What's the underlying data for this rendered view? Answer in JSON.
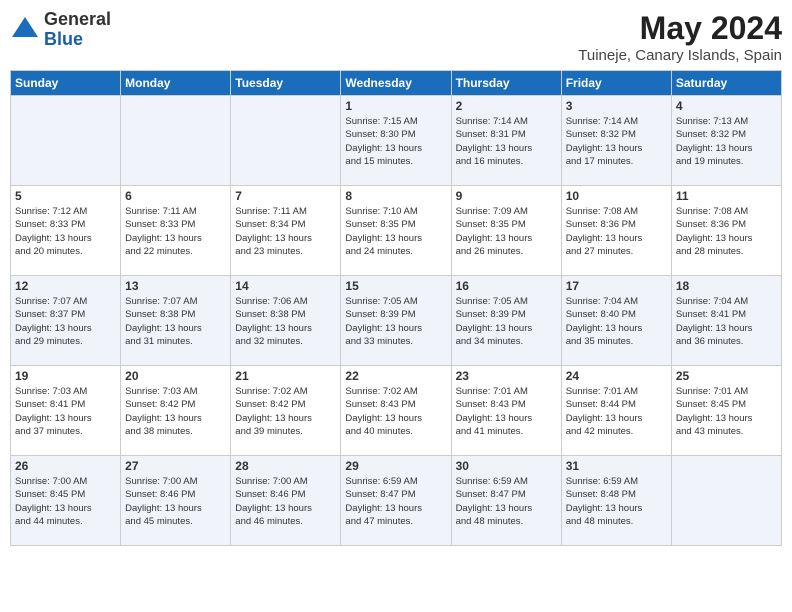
{
  "header": {
    "logo_general": "General",
    "logo_blue": "Blue",
    "month_year": "May 2024",
    "location": "Tuineje, Canary Islands, Spain"
  },
  "days_of_week": [
    "Sunday",
    "Monday",
    "Tuesday",
    "Wednesday",
    "Thursday",
    "Friday",
    "Saturday"
  ],
  "weeks": [
    [
      {
        "day": "",
        "info": ""
      },
      {
        "day": "",
        "info": ""
      },
      {
        "day": "",
        "info": ""
      },
      {
        "day": "1",
        "info": "Sunrise: 7:15 AM\nSunset: 8:30 PM\nDaylight: 13 hours\nand 15 minutes."
      },
      {
        "day": "2",
        "info": "Sunrise: 7:14 AM\nSunset: 8:31 PM\nDaylight: 13 hours\nand 16 minutes."
      },
      {
        "day": "3",
        "info": "Sunrise: 7:14 AM\nSunset: 8:32 PM\nDaylight: 13 hours\nand 17 minutes."
      },
      {
        "day": "4",
        "info": "Sunrise: 7:13 AM\nSunset: 8:32 PM\nDaylight: 13 hours\nand 19 minutes."
      }
    ],
    [
      {
        "day": "5",
        "info": "Sunrise: 7:12 AM\nSunset: 8:33 PM\nDaylight: 13 hours\nand 20 minutes."
      },
      {
        "day": "6",
        "info": "Sunrise: 7:11 AM\nSunset: 8:33 PM\nDaylight: 13 hours\nand 22 minutes."
      },
      {
        "day": "7",
        "info": "Sunrise: 7:11 AM\nSunset: 8:34 PM\nDaylight: 13 hours\nand 23 minutes."
      },
      {
        "day": "8",
        "info": "Sunrise: 7:10 AM\nSunset: 8:35 PM\nDaylight: 13 hours\nand 24 minutes."
      },
      {
        "day": "9",
        "info": "Sunrise: 7:09 AM\nSunset: 8:35 PM\nDaylight: 13 hours\nand 26 minutes."
      },
      {
        "day": "10",
        "info": "Sunrise: 7:08 AM\nSunset: 8:36 PM\nDaylight: 13 hours\nand 27 minutes."
      },
      {
        "day": "11",
        "info": "Sunrise: 7:08 AM\nSunset: 8:36 PM\nDaylight: 13 hours\nand 28 minutes."
      }
    ],
    [
      {
        "day": "12",
        "info": "Sunrise: 7:07 AM\nSunset: 8:37 PM\nDaylight: 13 hours\nand 29 minutes."
      },
      {
        "day": "13",
        "info": "Sunrise: 7:07 AM\nSunset: 8:38 PM\nDaylight: 13 hours\nand 31 minutes."
      },
      {
        "day": "14",
        "info": "Sunrise: 7:06 AM\nSunset: 8:38 PM\nDaylight: 13 hours\nand 32 minutes."
      },
      {
        "day": "15",
        "info": "Sunrise: 7:05 AM\nSunset: 8:39 PM\nDaylight: 13 hours\nand 33 minutes."
      },
      {
        "day": "16",
        "info": "Sunrise: 7:05 AM\nSunset: 8:39 PM\nDaylight: 13 hours\nand 34 minutes."
      },
      {
        "day": "17",
        "info": "Sunrise: 7:04 AM\nSunset: 8:40 PM\nDaylight: 13 hours\nand 35 minutes."
      },
      {
        "day": "18",
        "info": "Sunrise: 7:04 AM\nSunset: 8:41 PM\nDaylight: 13 hours\nand 36 minutes."
      }
    ],
    [
      {
        "day": "19",
        "info": "Sunrise: 7:03 AM\nSunset: 8:41 PM\nDaylight: 13 hours\nand 37 minutes."
      },
      {
        "day": "20",
        "info": "Sunrise: 7:03 AM\nSunset: 8:42 PM\nDaylight: 13 hours\nand 38 minutes."
      },
      {
        "day": "21",
        "info": "Sunrise: 7:02 AM\nSunset: 8:42 PM\nDaylight: 13 hours\nand 39 minutes."
      },
      {
        "day": "22",
        "info": "Sunrise: 7:02 AM\nSunset: 8:43 PM\nDaylight: 13 hours\nand 40 minutes."
      },
      {
        "day": "23",
        "info": "Sunrise: 7:01 AM\nSunset: 8:43 PM\nDaylight: 13 hours\nand 41 minutes."
      },
      {
        "day": "24",
        "info": "Sunrise: 7:01 AM\nSunset: 8:44 PM\nDaylight: 13 hours\nand 42 minutes."
      },
      {
        "day": "25",
        "info": "Sunrise: 7:01 AM\nSunset: 8:45 PM\nDaylight: 13 hours\nand 43 minutes."
      }
    ],
    [
      {
        "day": "26",
        "info": "Sunrise: 7:00 AM\nSunset: 8:45 PM\nDaylight: 13 hours\nand 44 minutes."
      },
      {
        "day": "27",
        "info": "Sunrise: 7:00 AM\nSunset: 8:46 PM\nDaylight: 13 hours\nand 45 minutes."
      },
      {
        "day": "28",
        "info": "Sunrise: 7:00 AM\nSunset: 8:46 PM\nDaylight: 13 hours\nand 46 minutes."
      },
      {
        "day": "29",
        "info": "Sunrise: 6:59 AM\nSunset: 8:47 PM\nDaylight: 13 hours\nand 47 minutes."
      },
      {
        "day": "30",
        "info": "Sunrise: 6:59 AM\nSunset: 8:47 PM\nDaylight: 13 hours\nand 48 minutes."
      },
      {
        "day": "31",
        "info": "Sunrise: 6:59 AM\nSunset: 8:48 PM\nDaylight: 13 hours\nand 48 minutes."
      },
      {
        "day": "",
        "info": ""
      }
    ]
  ]
}
